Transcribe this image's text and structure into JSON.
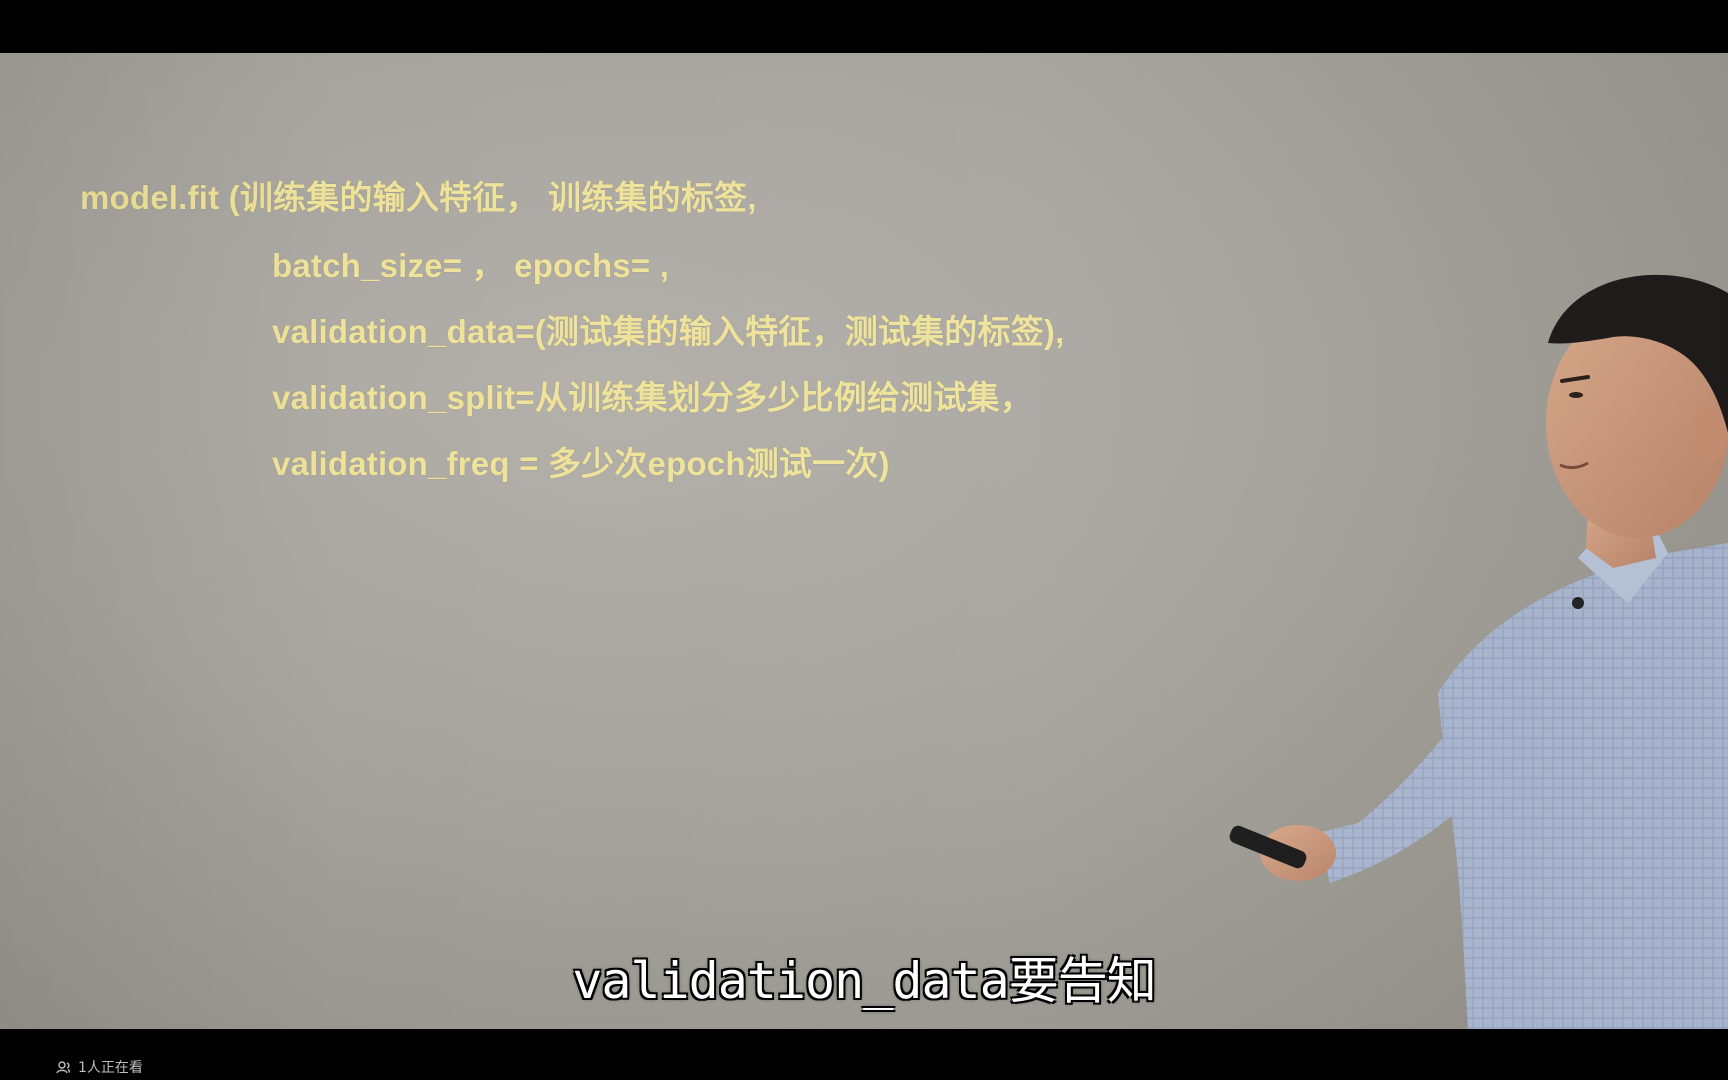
{
  "slide": {
    "lines": [
      "model.fit (训练集的输入特征， 训练集的标签,",
      "batch_size=  ，  epochs=  ,",
      "validation_data=(测试集的输入特征，测试集的标签),",
      "validation_split=从训练集划分多少比例给测试集，",
      "validation_freq = 多少次epoch测试一次)"
    ]
  },
  "subtitle": "validation_data要告知",
  "footer": {
    "viewer_count": "1人正在看",
    "viewer_icon": "viewers-icon"
  },
  "colors": {
    "slide_text": "#efe39a",
    "background": "#a7a49f",
    "letterbox": "#000000"
  }
}
